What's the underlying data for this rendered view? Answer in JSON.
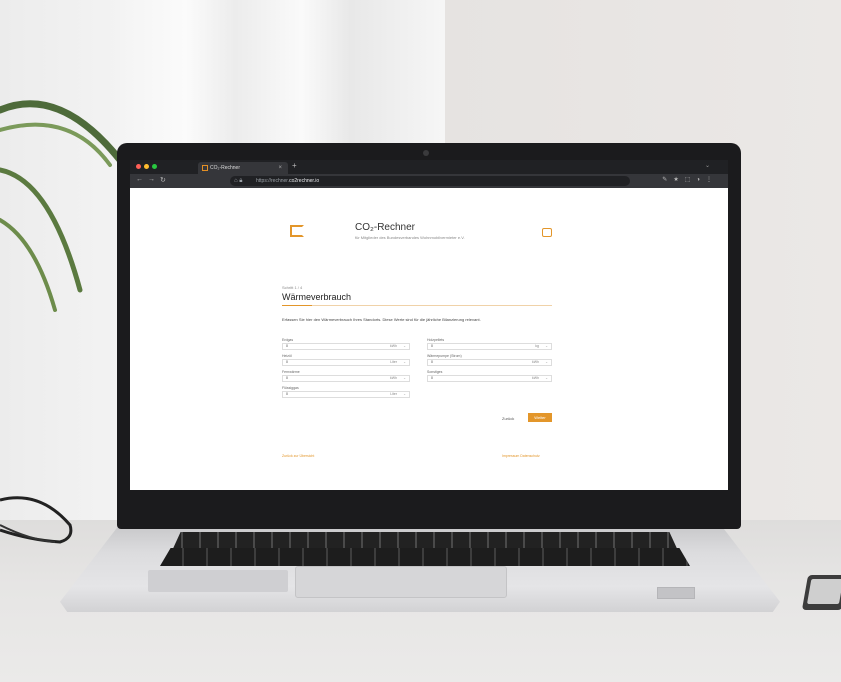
{
  "browser": {
    "tab_title": "CO₂-Rechner",
    "new_tab": "+",
    "url_prefix": "https://rechner.",
    "url_domain": "co2rechner.io",
    "window_dot_colors": [
      "#ff5f57",
      "#febc2e",
      "#28c840"
    ],
    "accent_color": "#e3962a"
  },
  "page": {
    "brand": "CO₂-Rechner",
    "brand_subtitle": "für Mitglieder des Bundesverbandes Wohnmobilvermieter e.V.",
    "step_label": "Schritt 1 / 4",
    "title": "Wärmeverbrauch",
    "description": "Erfassen Sie hier den Wärmeverbrauch Ihres Standorts. Diese Werte sind für die jährliche Bilanzierung relevant.",
    "left_fields": [
      {
        "label": "Erdgas",
        "value": "0",
        "unit": "kWh"
      },
      {
        "label": "Heizöl",
        "value": "0",
        "unit": "Liter"
      },
      {
        "label": "Fernwärme",
        "value": "0",
        "unit": "kWh"
      },
      {
        "label": "Flüssiggas",
        "value": "0",
        "unit": "Liter"
      }
    ],
    "right_fields": [
      {
        "label": "Holzpellets",
        "value": "0",
        "unit": "kg"
      },
      {
        "label": "Wärmepumpe (Strom)",
        "value": "0",
        "unit": "kWh"
      },
      {
        "label": "Sonstiges",
        "value": "0",
        "unit": "kWh"
      }
    ],
    "back_label": "Zurück",
    "next_label": "Weiter",
    "footer_left": "Zurück zur Übersicht",
    "footer_right": "Impressum   Datenschutz"
  }
}
